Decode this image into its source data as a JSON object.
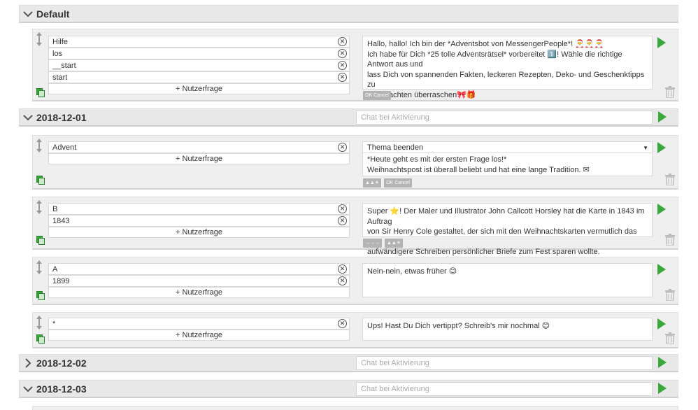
{
  "sections": [
    {
      "title": "Default",
      "expanded": true
    },
    {
      "title": "2018-12-01",
      "expanded": true,
      "chat_placeholder": "Chat bei Aktivierung"
    },
    {
      "title": "2018-12-02",
      "expanded": false,
      "chat_placeholder": "Chat bei Aktivierung"
    },
    {
      "title": "2018-12-03",
      "expanded": true,
      "chat_placeholder": "Chat bei Aktivierung"
    }
  ],
  "add_label": "+ Nutzerfrage",
  "cards": [
    {
      "questions": [
        "Hilfe",
        "los",
        "__start",
        "start"
      ],
      "answer_lines": [
        "Hallo, hallo! Ich bin der *Adventsbot von MessengerPeople*! 🎅🎅🎅",
        "Ich habe für Dich *25 tolle Adventsrätsel* vorbereitet 1️⃣! Wähle die richtige Antwort aus und",
        "lass Dich von spannenden Fakten, leckeren Rezepten, Deko- und Geschenktipps  zu",
        "Weihnachten überraschen🎀🎁"
      ],
      "chips": [
        "OK Cancel"
      ]
    },
    {
      "questions": [
        "Advent"
      ],
      "select_value": "Thema beenden",
      "answer_lines": [
        "*Heute geht es mit der ersten Frage los!*",
        "Weihnachtspost ist überall beliebt und hat eine lange Tradition. ✉"
      ],
      "chips": [
        "▲▲☀",
        "OK Cancel"
      ]
    },
    {
      "questions": [
        "B",
        "1843"
      ],
      "answer_lines": [
        "Super ⭐! Der Maler und Illustrator John Callcott Horsley hat die Karte in 1843 im Auftrag",
        "von Sir Henry Cole gestaltet, der sich mit den Weihnachtskarten vermutlich das viel",
        "aufwändigere Schreiben persönlicher Briefe zum Fest sparen wollte."
      ],
      "chips": [
        "→→→",
        "▲▲☀"
      ]
    },
    {
      "questions": [
        "A",
        "1899"
      ],
      "answer_lines": [
        "Nein-nein, etwas früher 😊"
      ],
      "chips": []
    },
    {
      "questions": [
        "*"
      ],
      "answer_lines": [
        "Ups! Hast Du Dich vertippt? Schreib's mir nochmal 😊"
      ],
      "chips": []
    }
  ],
  "colors": {
    "play": "#3aa83a",
    "header_bg": "#e8e8e8",
    "card_bg": "#efefef"
  }
}
